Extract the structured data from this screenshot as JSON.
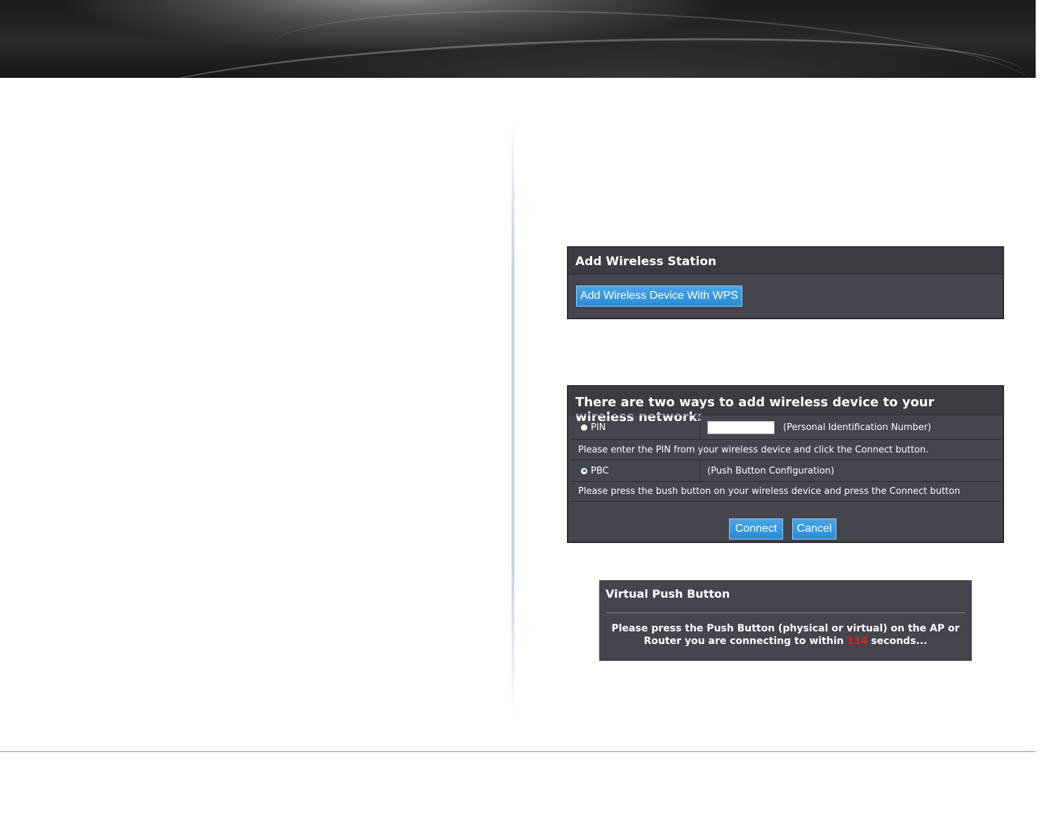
{
  "add_station": {
    "title": "Add Wireless Station",
    "button_label": "Add Wireless Device With WPS"
  },
  "ways": {
    "title": "There are two ways to add wireless device to your wireless network:",
    "pin": {
      "label": "PIN",
      "input_value": "",
      "description": "(Personal Identification Number)",
      "note": "Please enter the PIN from your wireless device and click the Connect button.",
      "selected": false
    },
    "pbc": {
      "label": "PBC",
      "description": "(Push Button Configuration)",
      "note": "Please press the bush button on your wireless device and press the Connect button",
      "selected": true
    },
    "connect_label": "Connect",
    "cancel_label": "Cancel"
  },
  "vpb": {
    "title": "Virtual Push Button",
    "line1": "Please press the Push Button (physical or virtual) on the AP or",
    "line2_before": "Router you are connecting to within",
    "countdown": "114",
    "line2_after": "seconds..."
  },
  "colors": {
    "panel_bg": "#45454d",
    "button_blue": "#2a8ad6",
    "countdown_red": "#e02020",
    "footer_line": "#6f8fb4"
  }
}
